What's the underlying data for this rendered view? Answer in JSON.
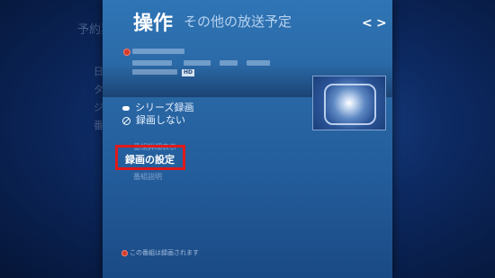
{
  "background": {
    "title": "予約",
    "title_suffix": "票",
    "menu": [
      "日",
      "タ",
      "ジ",
      "番"
    ]
  },
  "dialog": {
    "title": "操作",
    "subtitle": "その他の放送予定",
    "nav_prev": "<",
    "nav_next": ">",
    "program": {
      "hd_badge": "HD"
    },
    "options": [
      {
        "icon": "cloud-icon",
        "label": "シリーズ録画"
      },
      {
        "icon": "no-record-icon",
        "label": "録画しない"
      }
    ],
    "menu": {
      "ghost_above": "番組詳細表示",
      "selected": "録画の設定",
      "ghost_below": "番組説明"
    },
    "footer": "この番組は録画されます"
  },
  "colors": {
    "highlight_border": "#e01a1a",
    "record_dot": "#d33b2b",
    "panel": "#2a68a6"
  }
}
